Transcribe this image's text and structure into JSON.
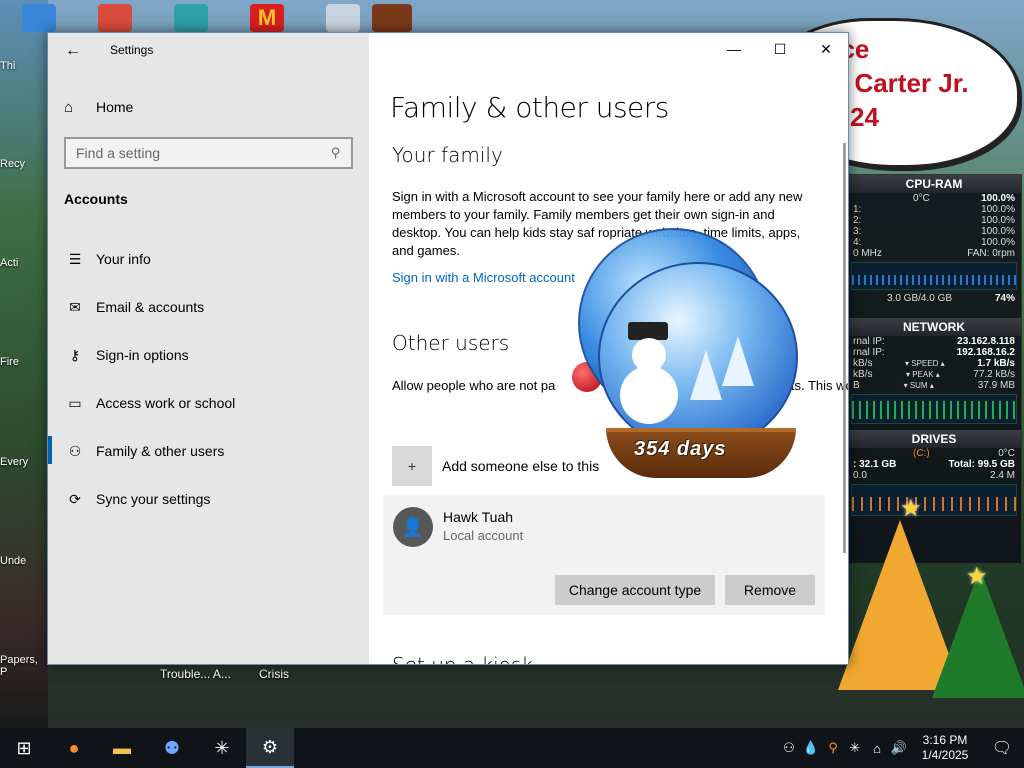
{
  "window": {
    "title": "Settings",
    "back_icon": "back-arrow-icon",
    "minimize": "—",
    "maximize": "☐",
    "close": "✕"
  },
  "sidebar": {
    "home_label": "Home",
    "search_placeholder": "Find a setting",
    "section": "Accounts",
    "items": [
      {
        "label": "Your info",
        "icon": "person-card-icon"
      },
      {
        "label": "Email & accounts",
        "icon": "mail-icon"
      },
      {
        "label": "Sign-in options",
        "icon": "key-icon"
      },
      {
        "label": "Access work or school",
        "icon": "briefcase-icon"
      },
      {
        "label": "Family & other users",
        "icon": "people-icon",
        "active": true
      },
      {
        "label": "Sync your settings",
        "icon": "sync-icon"
      }
    ]
  },
  "main": {
    "page_title": "Family & other users",
    "family_heading": "Your family",
    "family_text": "Sign in with a Microsoft account to see your family here or add any new members to your family. Family members get their own sign-in and desktop. You can help kids stay saf   ropriate websites, time limits, apps, and games.",
    "family_link": "Sign in with a Microsoft account",
    "other_heading": "Other users",
    "other_text": "Allow people who are not pa                                              own accounts. This won't add them to",
    "add_label": "Add someone else to this",
    "user": {
      "name": "Hawk Tuah",
      "type": "Local account",
      "change_button": "Change account type",
      "remove_button": "Remove"
    },
    "kiosk_heading": "Set up a kiosk"
  },
  "snow_globe": {
    "label": "354 days"
  },
  "poster": {
    "line1": "ace",
    "line2": "l Carter Jr.",
    "line3": "24"
  },
  "gadgets": {
    "cpu": {
      "title": "CPU-RAM",
      "temp": "0°C",
      "total": "100.0%",
      "cores": [
        {
          "id": "1:",
          "value": "100.0%"
        },
        {
          "id": "2:",
          "value": "100.0%"
        },
        {
          "id": "3:",
          "value": "100.0%"
        },
        {
          "id": "4:",
          "value": "100.0%"
        }
      ],
      "mhz": "0 MHz",
      "fan": "FAN: 0rpm",
      "ram": "3.0 GB/4.0 GB",
      "ram_pct": "74%"
    },
    "network": {
      "title": "NETWORK",
      "ext_ip_label": "rnal IP:",
      "ext_ip": "23.162.8.118",
      "int_ip_label": "rnal IP:",
      "int_ip": "192.168.16.2",
      "speed_label": "▾ SPEED ▴",
      "speed_left": "kB/s",
      "speed": "1.7 kB/s",
      "peak_label": "▾ PEAK ▴",
      "peak_left": "kB/s",
      "peak": "77.2 kB/s",
      "sum_label": "▾ SUM ▴",
      "sum_left": "B",
      "sum": "37.9 MB"
    },
    "drives": {
      "title": "DRIVES",
      "drive": "(C:)",
      "temp": "0°C",
      "free": ": 32.1 GB",
      "total": "Total: 99.5 GB",
      "left": "0.0",
      "right": "2.4 M"
    }
  },
  "desktop": {
    "labels": [
      "Thi",
      "Recy",
      "Acti",
      "Fire",
      "Every",
      "Unde",
      "Papers, P"
    ],
    "bottom_labels": [
      "Trouble... A...",
      "Crisis"
    ]
  },
  "taskbar": {
    "time": "3:16 PM",
    "date": "1/4/2025",
    "apps": [
      "windows-start-icon",
      "firefox-icon",
      "file-explorer-icon",
      "people-app-icon",
      "sparkle-app-icon",
      "settings-gear-icon"
    ]
  },
  "colors": {
    "accent": "#0067c0",
    "active_bar": "#0063b1",
    "sidebar_bg": "#e6e6e6",
    "button_bg": "#cccccc"
  }
}
